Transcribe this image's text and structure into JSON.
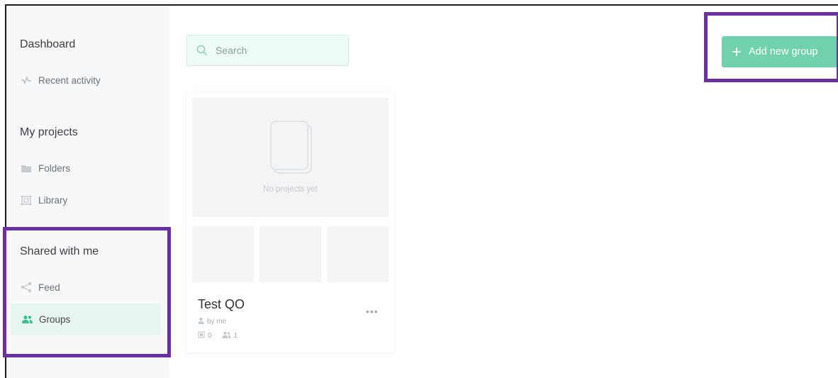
{
  "sidebar": {
    "dashboard": "Dashboard",
    "recent_activity": "Recent activity",
    "my_projects": "My projects",
    "folders": "Folders",
    "library": "Library",
    "shared_with_me": "Shared with me",
    "feed": "Feed",
    "groups": "Groups"
  },
  "search": {
    "placeholder": "Search"
  },
  "add_group": {
    "label": "Add new group",
    "icon": "plus-icon"
  },
  "card": {
    "empty_label": "No projects yet",
    "title": "Test QO",
    "by": "by me",
    "projects_count": "0",
    "members_count": "1",
    "more": "•••"
  },
  "colors": {
    "accent": "#70d2ac",
    "active_bg": "#e7f4ef",
    "highlight": "#6a2fa1",
    "icon_green": "#3cc08f"
  }
}
